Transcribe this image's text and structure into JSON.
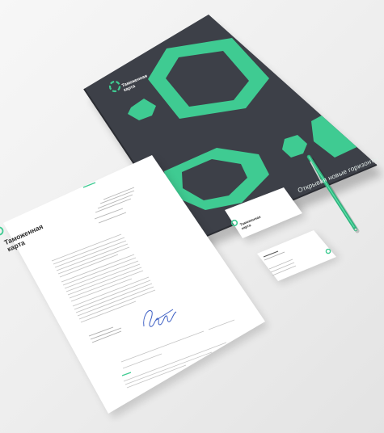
{
  "scene": {
    "description_colors": {
      "background": "#efefef",
      "folder": "#3d4048",
      "accent": "#3fcb92",
      "paper": "#ffffff"
    }
  },
  "folder": {
    "brand_line1": "Таможенная",
    "brand_line2": "карта",
    "slogan": "Открывая новые горизонты"
  },
  "business_card": {
    "brand_line1": "Таможенная",
    "brand_line2": "карта"
  },
  "letterhead": {
    "brand_line1": "Таможенная",
    "brand_line2": "карта"
  }
}
